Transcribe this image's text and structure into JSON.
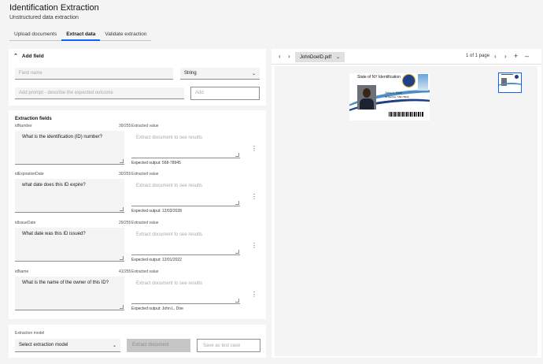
{
  "app": {
    "title": "Identification Extraction",
    "subtitle": "Unstructured data extraction"
  },
  "tabs": [
    {
      "label": "Upload documents",
      "active": false
    },
    {
      "label": "Extract data",
      "active": true
    },
    {
      "label": "Validate extraction",
      "active": false
    }
  ],
  "add_field": {
    "heading": "Add field",
    "field_name_placeholder": "Field name",
    "type_value": "String",
    "prompt_placeholder": "Add prompt - describe the expected outcome",
    "add_label": "Add"
  },
  "extraction_fields": {
    "title": "Extraction fields",
    "extracted_label": "Extracted value",
    "extract_placeholder": "Extract document to see results",
    "items": [
      {
        "name": "idNumber",
        "count": "39/255",
        "prompt": "What is the identification (ID) number?",
        "expected": "Expected output: 568-78945"
      },
      {
        "name": "idExpirationDate",
        "count": "30/255",
        "prompt": "what date does this ID expire?",
        "expected": "Expected output: 12/03/2028"
      },
      {
        "name": "idIssueDate",
        "count": "29/255",
        "prompt": "What date was this ID issued?",
        "expected": "Expected output: 12/01/2022"
      },
      {
        "name": "idName",
        "count": "41/255",
        "prompt": "What is the name of the owner of this ID?",
        "expected": "Expected output: John L. Doe"
      }
    ]
  },
  "model": {
    "label": "Extraction model",
    "select_value": "Select extraction model",
    "extract_label": "Extract document",
    "test_label": "Save as test case"
  },
  "viewer": {
    "file_name": "JohnDoeID.pdf",
    "page_info": "1 of 1 page",
    "card": {
      "title": "State of NY Identification",
      "name": "John L. Doe",
      "id_line": "ID Number: 568-78945"
    }
  },
  "icons": {
    "chevron_up": "chevron-up-icon",
    "chevron_down": "chevron-down-icon",
    "overflow": "overflow-menu-icon",
    "zoom_in": "zoom-in-icon",
    "zoom_out": "zoom-out-icon"
  },
  "colors": {
    "accent": "#0f62fe",
    "background": "#f4f4f4",
    "disabled": "#c6c6c6"
  }
}
